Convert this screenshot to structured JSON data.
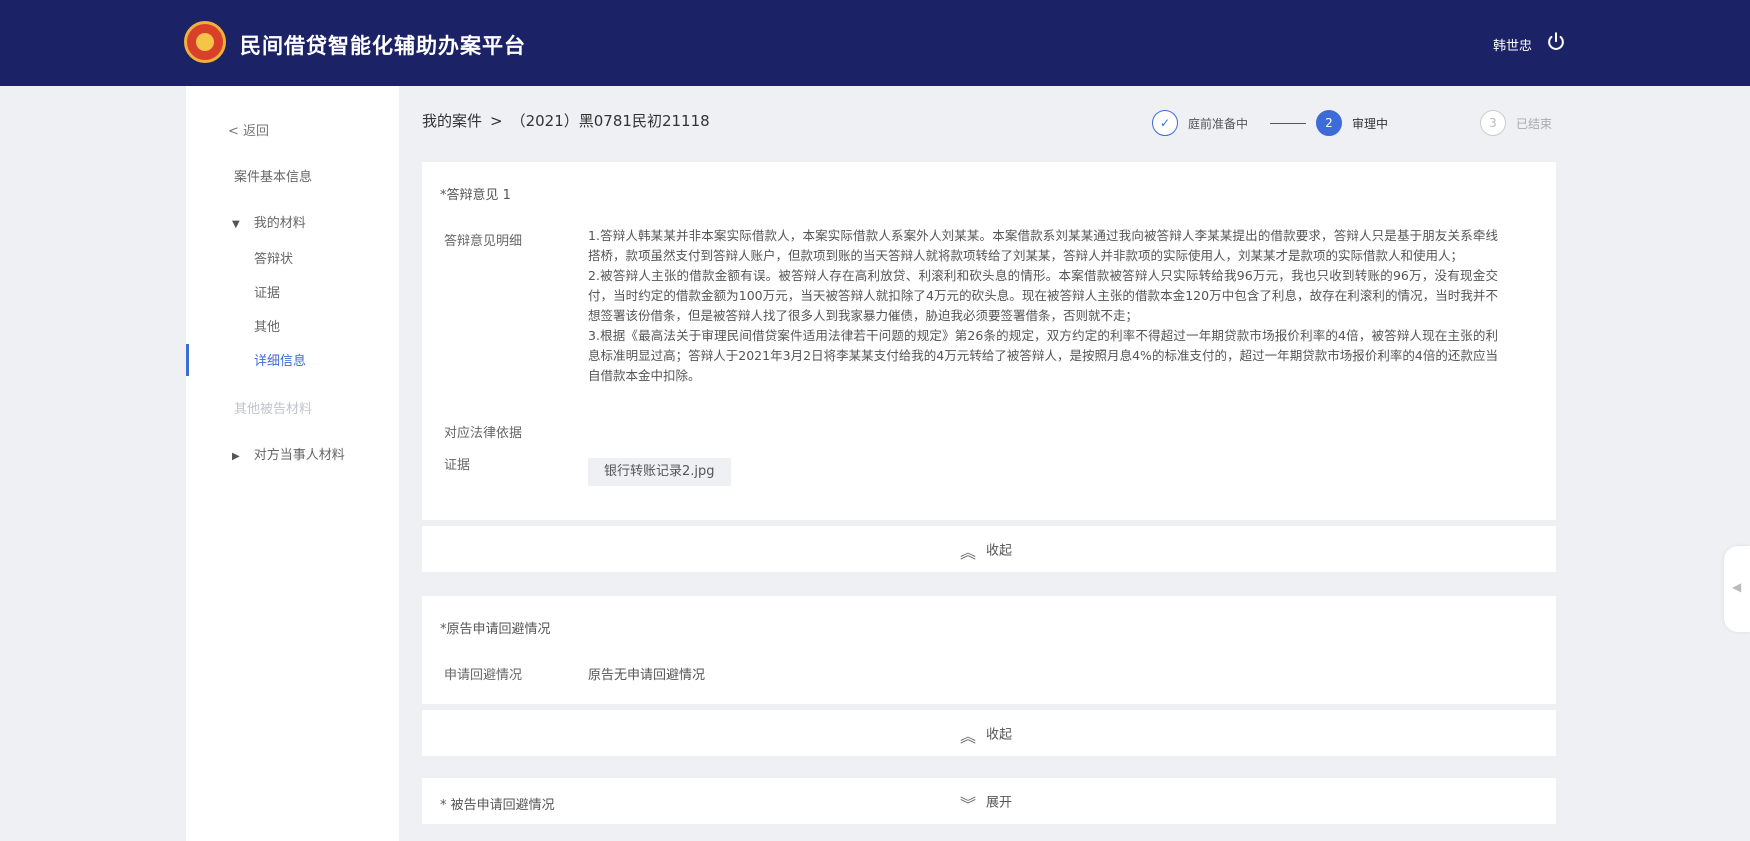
{
  "header": {
    "title": "民间借贷智能化辅助办案平台",
    "user_name": "韩世忠",
    "icons": {
      "logo": "court-emblem",
      "power": "power-icon"
    },
    "colors": {
      "bar": "#1c2266",
      "accent": "#3d6bd8"
    }
  },
  "sidebar": {
    "back": "< 返回",
    "basic_info": "案件基本信息",
    "my_materials": "我的材料",
    "materials": [
      "答辩状",
      "证据",
      "其他",
      "详细信息"
    ],
    "active_material": "详细信息",
    "other_defendant": "其他被告材料",
    "opponent": "对方当事人材料"
  },
  "breadcrumb": {
    "root": "我的案件",
    "separator": ">",
    "case_no": "（2021）黑0781民初21118"
  },
  "steps": [
    {
      "num": "✓",
      "label": "庭前准备中",
      "state": "done"
    },
    {
      "num": "2",
      "label": "审理中",
      "state": "active"
    },
    {
      "num": "3",
      "label": "已结束",
      "state": "pending"
    }
  ],
  "defense": {
    "title": "*答辩意见 1",
    "detail_label": "答辩意见明细",
    "paragraphs": [
      "1.答辩人韩某某并非本案实际借款人，本案实际借款人系案外人刘某某。本案借款系刘某某通过我向被答辩人李某某提出的借款要求，答辩人只是基于朋友关系牵线搭桥，款项虽然支付到答辩人账户，但款项到账的当天答辩人就将款项转给了刘某某，答辩人并非款项的实际使用人，刘某某才是款项的实际借款人和使用人；",
      "2.被答辩人主张的借款金额有误。被答辩人存在高利放贷、利滚利和砍头息的情形。本案借款被答辩人只实际转给我96万元，我也只收到转账的96万，没有现金交付，当时约定的借款金额为100万元，当天被答辩人就扣除了4万元的砍头息。现在被答辩人主张的借款本金120万中包含了利息，故存在利滚利的情况，当时我并不想签署该份借条，但是被答辩人找了很多人到我家暴力催债，胁迫我必须要签署借条，否则就不走；",
      "3.根据《最高法关于审理民间借贷案件适用法律若干问题的规定》第26条的规定，双方约定的利率不得超过一年期贷款市场报价利率的4倍，被答辩人现在主张的利息标准明显过高；答辩人于2021年3月2日将李某某支付给我的4万元转给了被答辩人，是按照月息4%的标准支付的，超过一年期贷款市场报价利率的4倍的还款应当自借款本金中扣除。"
    ],
    "law_label": "对应法律依据",
    "evidence_label": "证据",
    "evidence_file": "银行转账记录2.jpg"
  },
  "fold": {
    "collapse": "收起",
    "expand": "展开"
  },
  "plaintiff_recusal": {
    "title": "*原告申请回避情况",
    "label": "申请回避情况",
    "value": "原告无申请回避情况"
  },
  "defendant_recusal": {
    "title": "* 被告申请回避情况"
  }
}
